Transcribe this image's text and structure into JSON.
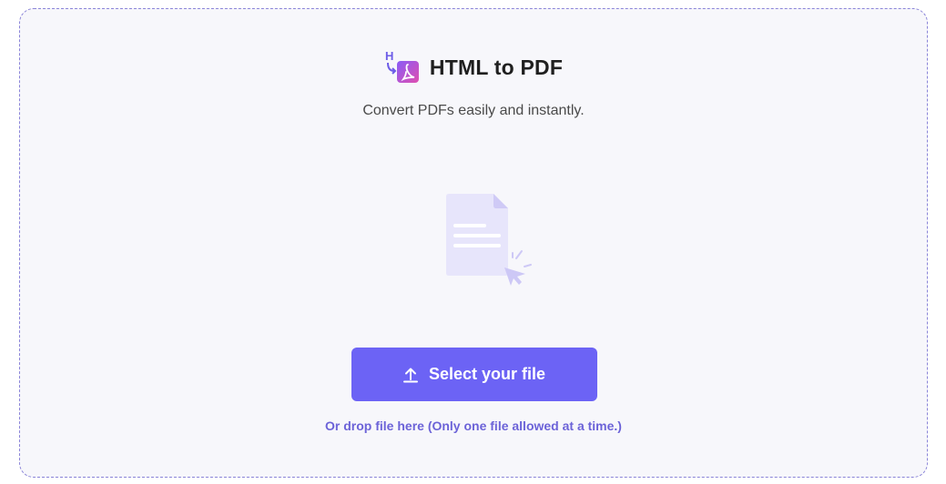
{
  "tool": {
    "title": "HTML to PDF",
    "subtitle": "Convert PDFs easily and instantly.",
    "logo_letter": "H"
  },
  "upload": {
    "button_label": "Select your file",
    "drop_hint": "Or drop file here (Only one file allowed at a time.)"
  },
  "icons": {
    "logo": "html-to-pdf-logo-icon",
    "illustration": "document-click-icon",
    "upload": "upload-arrow-icon"
  },
  "colors": {
    "accent": "#6c63f5",
    "dropzone_border": "#8a84d8",
    "dropzone_bg": "#f7f7fb",
    "hint_text": "#6c63d8"
  }
}
